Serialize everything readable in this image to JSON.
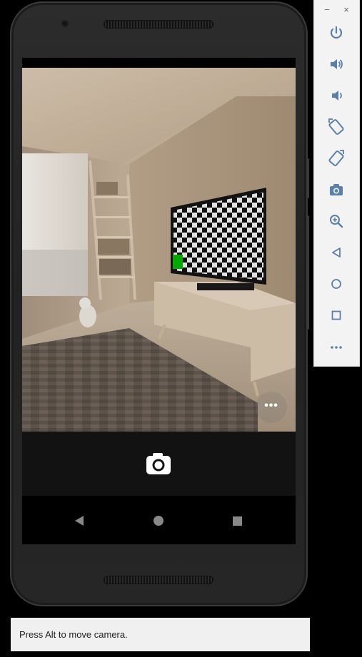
{
  "emulator": {
    "hint_text": "Press Alt to move camera.",
    "window_controls": [
      {
        "label": "−",
        "action": "minimize"
      },
      {
        "label": "×",
        "action": "close"
      }
    ],
    "toolbar_items": [
      {
        "name": "power-button",
        "icon": "power-icon"
      },
      {
        "name": "volume-up-button",
        "icon": "volume-up-icon"
      },
      {
        "name": "volume-down-button",
        "icon": "volume-down-icon"
      },
      {
        "name": "rotate-left-button",
        "icon": "rotate-left-icon"
      },
      {
        "name": "rotate-right-button",
        "icon": "rotate-right-icon"
      },
      {
        "name": "screenshot-button",
        "icon": "camera-icon"
      },
      {
        "name": "zoom-button",
        "icon": "zoom-in-icon"
      },
      {
        "name": "back-button",
        "icon": "back-triangle-icon"
      },
      {
        "name": "home-button",
        "icon": "home-circle-icon"
      },
      {
        "name": "overview-button",
        "icon": "overview-square-icon"
      },
      {
        "name": "more-options-button",
        "icon": "more-horizontal-icon"
      }
    ],
    "accent_color": "#5a7fa8"
  },
  "camera_app": {
    "more_button_label": "•••",
    "shutter_icon": "camera-icon",
    "nav": {
      "back_icon": "back-triangle-icon",
      "home_icon": "home-circle-icon",
      "recents_icon": "recents-square-icon"
    },
    "scene": {
      "tv_marker_color": "#00b400"
    }
  }
}
